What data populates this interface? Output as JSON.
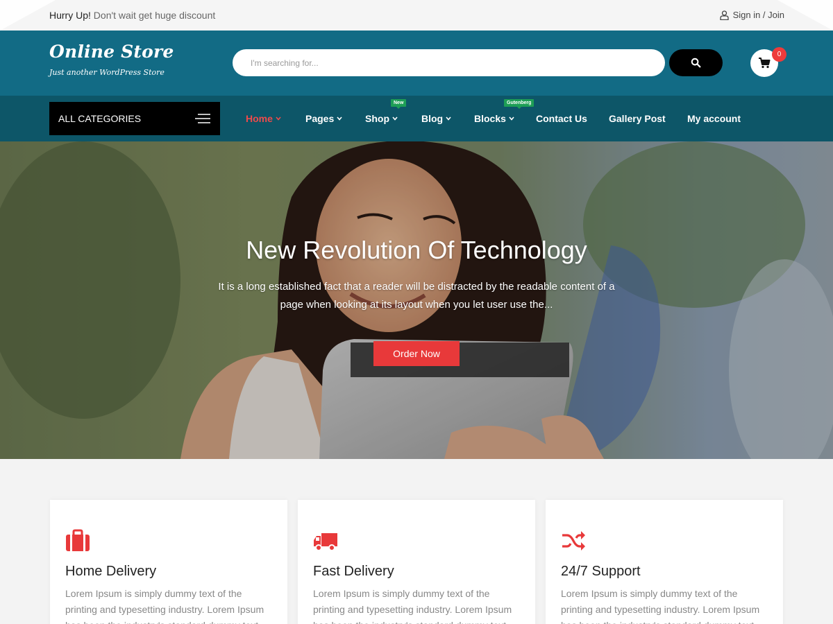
{
  "topbar": {
    "promo_strong": "Hurry Up!",
    "promo_rest": "Don't wait get huge discount",
    "signin": "Sign in / Join"
  },
  "header": {
    "logo_title": "Online Store",
    "logo_tagline": "Just another WordPress Store",
    "search_placeholder": "I'm searching for...",
    "cart_count": "0"
  },
  "nav": {
    "all_categories": "ALL CATEGORIES",
    "items": [
      {
        "label": "Home",
        "dropdown": true,
        "active": true
      },
      {
        "label": "Pages",
        "dropdown": true
      },
      {
        "label": "Shop",
        "dropdown": true,
        "badge": "New"
      },
      {
        "label": "Blog",
        "dropdown": true
      },
      {
        "label": "Blocks",
        "dropdown": true,
        "badge": "Gutenberg"
      },
      {
        "label": "Contact Us"
      },
      {
        "label": "Gallery Post"
      },
      {
        "label": "My account"
      }
    ]
  },
  "hero": {
    "title": "New Revolution Of Technology",
    "description": "It is a long established fact that a reader will be distracted by the readable content of a page when looking at its layout when you let user use the...",
    "button": "Order Now"
  },
  "features": [
    {
      "icon": "briefcase-icon",
      "title": "Home Delivery",
      "text": "Lorem Ipsum is simply dummy text of the printing and typesetting industry. Lorem Ipsum has been the industry's standard dummy text"
    },
    {
      "icon": "truck-icon",
      "title": "Fast Delivery",
      "text": "Lorem Ipsum is simply dummy text of the printing and typesetting industry. Lorem Ipsum has been the industry's standard dummy text"
    },
    {
      "icon": "shuffle-icon",
      "title": "24/7 Support",
      "text": "Lorem Ipsum is simply dummy text of the printing and typesetting industry. Lorem Ipsum has been the industry's standard dummy text"
    }
  ],
  "colors": {
    "header_bg": "#126b85",
    "nav_bg": "#0d5668",
    "accent": "#e8393a",
    "badge": "#1e9e56"
  }
}
